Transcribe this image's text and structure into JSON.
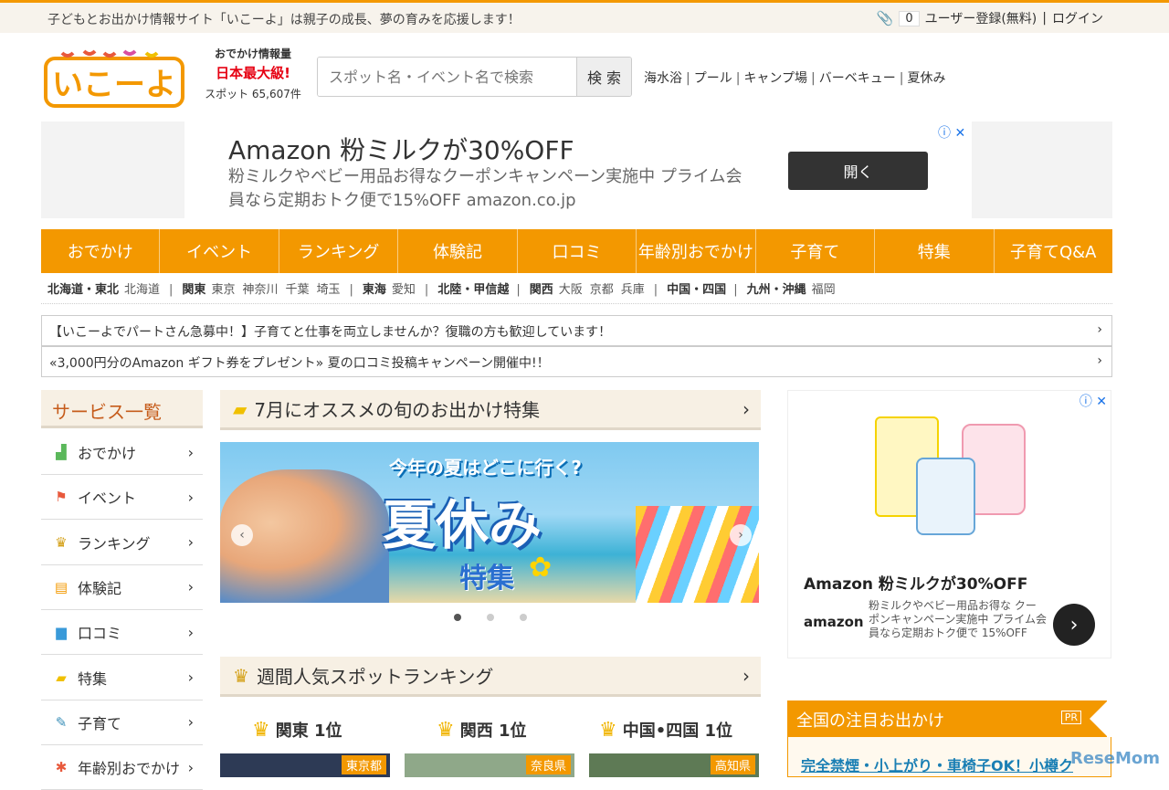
{
  "topbar": {
    "tagline": "子どもとお出かけ情報サイト「いこーよ」は親子の成長、夢の育みを応援します！",
    "clip_count": "0",
    "register": "ユーザー登録(無料)",
    "sep": "|",
    "login": "ログイン"
  },
  "logo": {
    "text": "いこーよ"
  },
  "logo_info": {
    "line1": "おでかけ情報量",
    "line2": "日本最大級!",
    "line3": "スポット 65,607件"
  },
  "search": {
    "placeholder": "スポット名・イベント名で検索",
    "button": "検 索"
  },
  "hot_links": [
    "海水浴",
    "プール",
    "キャンプ場",
    "バーベキュー",
    "夏休み"
  ],
  "ad_top": {
    "title": "Amazon 粉ミルクが30%OFF",
    "desc": "粉ミルクやベビー用品お得なクーポンキャンペーン実施中 プライム会員なら定期おトク便で15%OFF amazon.co.jp",
    "button": "開く",
    "adchoice": "ⓘ ✕"
  },
  "main_nav": [
    "おでかけ",
    "イベント",
    "ランキング",
    "体験記",
    "口コミ",
    "年齢別おでかけ",
    "子育て",
    "特集",
    "子育てQ&A"
  ],
  "regions": [
    {
      "name": "北海道・東北",
      "cities": [
        "北海道"
      ]
    },
    {
      "name": "関東",
      "cities": [
        "東京",
        "神奈川",
        "千葉",
        "埼玉"
      ]
    },
    {
      "name": "東海",
      "cities": [
        "愛知"
      ]
    },
    {
      "name": "北陸・甲信越",
      "cities": []
    },
    {
      "name": "関西",
      "cities": [
        "大阪",
        "京都",
        "兵庫"
      ]
    },
    {
      "name": "中国・四国",
      "cities": []
    },
    {
      "name": "九州・沖縄",
      "cities": [
        "福岡"
      ]
    }
  ],
  "notices": [
    "【いこーよでパートさん急募中！】子育てと仕事を両立しませんか？復職の方も歓迎しています！",
    "«3,000円分のAmazon ギフト券をプレゼント» 夏の口コミ投稿キャンペーン開催中!！"
  ],
  "sidebar": {
    "title": "サービス一覧",
    "items": [
      {
        "label": "おでかけ",
        "icon": "▟",
        "color": "#5bb85b"
      },
      {
        "label": "イベント",
        "icon": "⚑",
        "color": "#e8593c"
      },
      {
        "label": "ランキング",
        "icon": "♛",
        "color": "#d4a017"
      },
      {
        "label": "体験記",
        "icon": "▤",
        "color": "#f39800"
      },
      {
        "label": "口コミ",
        "icon": "▆",
        "color": "#3a9ad9"
      },
      {
        "label": "特集",
        "icon": "▰",
        "color": "#f0c000"
      },
      {
        "label": "子育て",
        "icon": "✎",
        "color": "#3a8fb8"
      },
      {
        "label": "年齢別おでかけ",
        "icon": "✱",
        "color": "#e8593c"
      }
    ]
  },
  "feature": {
    "title": "7月にオススメの旬のお出かけ特集",
    "banner_line1": "今年の夏はどこに行く?",
    "banner_line2": "夏休み",
    "banner_line3": "特集"
  },
  "ranking": {
    "title": "週間人気スポットランキング",
    "columns": [
      {
        "region": "関東 1位",
        "pref": "東京都"
      },
      {
        "region": "関西 1位",
        "pref": "奈良県"
      },
      {
        "region": "中国•四国 1位",
        "pref": "高知県"
      }
    ]
  },
  "ad_side": {
    "title": "Amazon 粉ミルクが30%OFF",
    "brand": "amazon",
    "desc": "粉ミルクやベビー用品お得な クーポンキャンペーン実施中 プライム会員なら定期おトク便で 15%OFF",
    "adchoice": "ⓘ ✕"
  },
  "pickup": {
    "title": "全国の注目お出かけ",
    "pr": "PR",
    "link": "完全禁煙・小上がり・車椅子OK！小樽ク"
  },
  "watermark": "ReseMom"
}
